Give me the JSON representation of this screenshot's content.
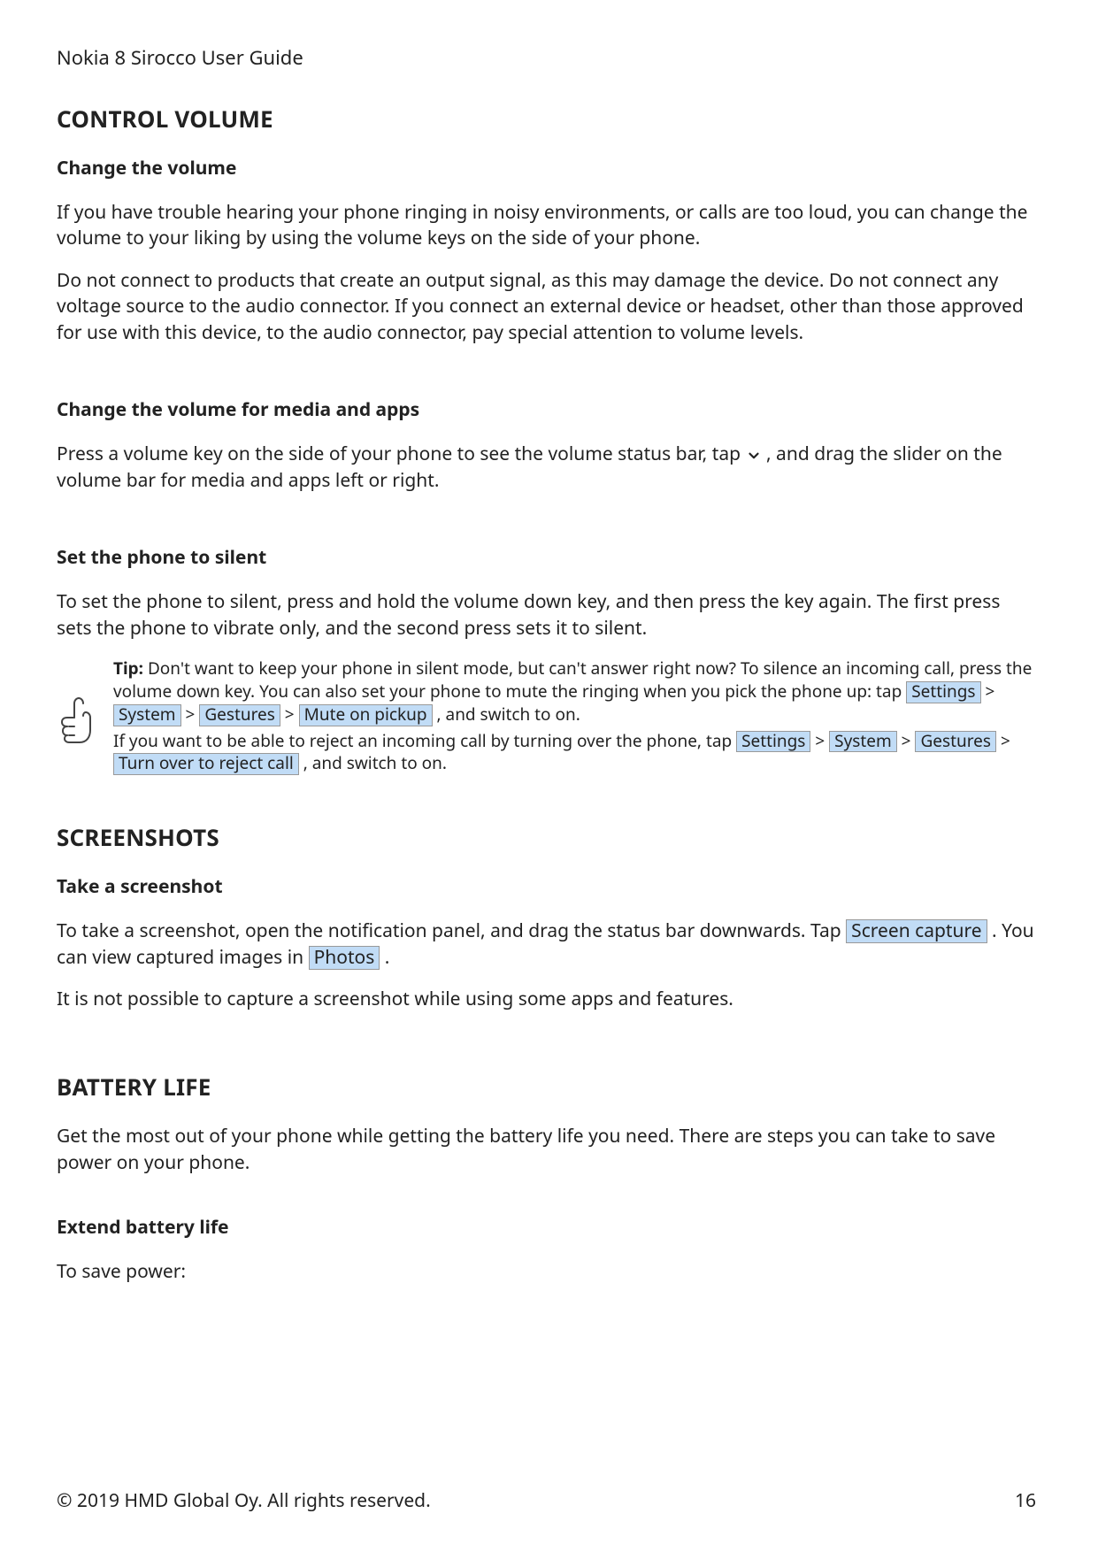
{
  "header": "Nokia 8 Sirocco User Guide",
  "s1": {
    "title": "CONTROL VOLUME",
    "sub1": "Change the volume",
    "p1": "If you have trouble hearing your phone ringing in noisy environments, or calls are too loud, you can change the volume to your liking by using the volume keys on the side of your phone.",
    "p2": "Do not connect to products that create an output signal, as this may damage the device. Do not connect any voltage source to the audio connector. If you connect an external device or headset, other than those approved for use with this device, to the audio connector, pay special attention to volume levels.",
    "sub2": "Change the volume for media and apps",
    "p3_a": "Press a volume key on the side of your phone to see the volume status bar, tap ",
    "p3_b": " , and drag the slider on the volume bar for media and apps left or right.",
    "sub3": "Set the phone to silent",
    "p4": "To set the phone to silent, press and hold the volume down key, and then press the key again. The first press sets the phone to vibrate only, and the second press sets it to silent.",
    "tip": {
      "label": "Tip:",
      "l1": " Don't want to keep your phone in silent mode, but can't answer right now? To silence an incoming call, press the volume down key. You can also set your phone to mute the ringing when you pick the phone up: tap ",
      "c1": "Settings",
      "gt": " > ",
      "c2": "System",
      "c3": "Gestures",
      "c4": "Mute on pickup",
      "l1b": " , and switch to on.",
      "l2a": "If you want to be able to reject an incoming call by turning over the phone, tap ",
      "c5": "Settings",
      "c6": "System",
      "c7": "Gestures",
      "c8": "Turn over to reject call",
      "l2b": " , and switch to on."
    }
  },
  "s2": {
    "title": "SCREENSHOTS",
    "sub1": "Take a screenshot",
    "p1a": "To take a screenshot, open the notification panel, and drag the status bar downwards. Tap ",
    "c1": "Screen capture",
    "p1b": " . You can view captured images in ",
    "c2": "Photos",
    "p1c": " .",
    "p2": "It is not possible to capture a screenshot while using some apps and features."
  },
  "s3": {
    "title": "BATTERY LIFE",
    "p1": "Get the most out of your phone while getting the battery life you need. There are steps you can take to save power on your phone.",
    "sub1": "Extend battery life",
    "p2": "To save power:"
  },
  "footer": {
    "copyright": "© 2019 HMD Global Oy. All rights reserved.",
    "page": "16"
  }
}
